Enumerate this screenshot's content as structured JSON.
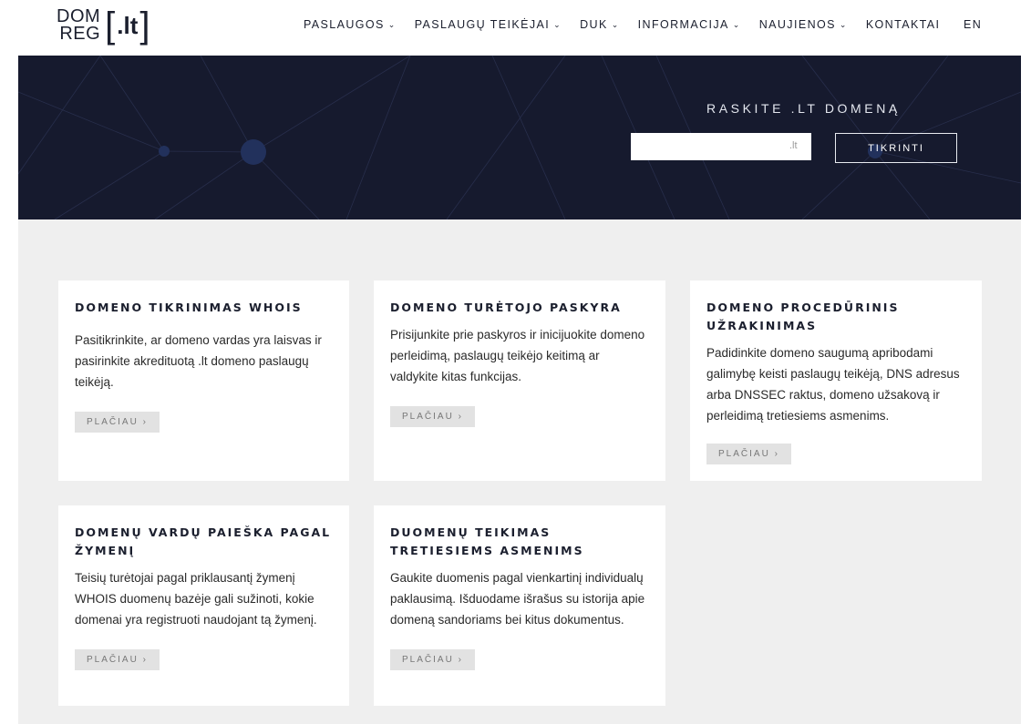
{
  "header": {
    "logo": {
      "line1": "DOM",
      "line2": "REG",
      "bracket_open": "[",
      "bracket_text": ".lt",
      "bracket_close": "]"
    },
    "nav": [
      {
        "label": "PASLAUGOS",
        "dropdown": true
      },
      {
        "label": "PASLAUGŲ TEIKĖJAI",
        "dropdown": true
      },
      {
        "label": "DUK",
        "dropdown": true
      },
      {
        "label": "INFORMACIJA",
        "dropdown": true
      },
      {
        "label": "NAUJIENOS",
        "dropdown": true
      },
      {
        "label": "KONTAKTAI",
        "dropdown": false
      }
    ],
    "chevron": "⌄",
    "language": "EN"
  },
  "hero": {
    "title": "RASKITE .LT DOMENĄ",
    "search_placeholder": "",
    "search_suffix": ".lt",
    "button_label": "TIKRINTI"
  },
  "cards": [
    {
      "title": "DOMENO TIKRINIMAS WHOIS",
      "text": "Pasitikrinkite, ar domeno vardas yra laisvas ir pasirinkite akredituotą .lt domeno paslaugų teikėją.",
      "button": "PLAČIAU ›"
    },
    {
      "title": "DOMENO TURĖTOJO PASKYRA",
      "text": "Prisijunkite prie paskyros ir inicijuokite domeno perleidimą, paslaugų teikėjo keitimą ar valdykite kitas funkcijas.",
      "button": "PLAČIAU ›"
    },
    {
      "title": "DOMENO PROCEDŪRINIS UŽRAKINIMAS",
      "text": "Padidinkite domeno saugumą apribodami galimybę keisti paslaugų teikėją, DNS adresus arba DNSSEC raktus, domeno užsakovą ir perleidimą tretiesiems asmenims.",
      "button": "PLAČIAU ›"
    },
    {
      "title": "DOMENŲ VARDŲ PAIEŠKA PAGAL ŽYMENĮ",
      "text": "Teisių turėtojai pagal priklausantį žymenį WHOIS duomenų bazėje gali sužinoti, kokie domenai yra registruoti naudojant tą žymenį.",
      "button": "PLAČIAU ›"
    },
    {
      "title": "DUOMENŲ TEIKIMAS TRETIESIEMS ASMENIMS",
      "text": "Gaukite duomenis pagal vienkartinį individualų paklausimą. Išduodame išrašus su istorija apie domeną sandoriams bei kitus dokumentus.",
      "button": "PLAČIAU ›"
    }
  ],
  "colors": {
    "hero_bg": "#161a2e",
    "content_bg": "#efefef",
    "text_dark": "#1b1f2e",
    "button_bg": "#e2e2e2"
  }
}
